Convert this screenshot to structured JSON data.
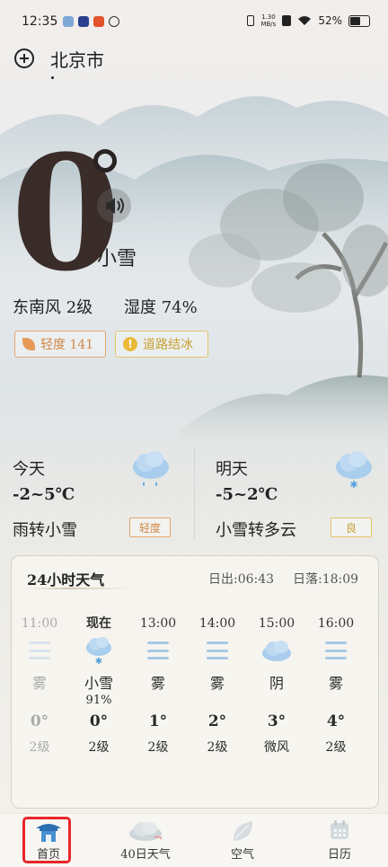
{
  "status_bar": {
    "time": "12:35",
    "net_speed_top": "1.30",
    "net_speed_bottom": "MB/s",
    "battery": "52%"
  },
  "location": {
    "city": "北京市"
  },
  "current": {
    "temperature": "0",
    "condition": "小雪",
    "wind": "东南风 2级",
    "humidity": "湿度 74%",
    "aqi_badge": "轻度 141",
    "alert_badge": "道路结冰"
  },
  "today": {
    "label": "今天",
    "temp": "-2~5℃",
    "condition": "雨转小雪",
    "aqi": "轻度"
  },
  "tomorrow": {
    "label": "明天",
    "temp": "-5~2℃",
    "condition": "小雪转多云",
    "aqi": "良"
  },
  "hourly": {
    "title": "24小时天气",
    "sunrise": "日出:06:43",
    "sunset": "日落:18:09",
    "items": [
      {
        "time": "11:00",
        "icon": "fog-icon",
        "cond": "雾",
        "precip": "",
        "temp": "0°",
        "wind": "2级",
        "past": true
      },
      {
        "time": "现在",
        "icon": "snow-cloud-icon",
        "cond": "小雪",
        "precip": "91%",
        "temp": "0°",
        "wind": "2级",
        "past": false
      },
      {
        "time": "13:00",
        "icon": "fog-icon",
        "cond": "雾",
        "precip": "",
        "temp": "1°",
        "wind": "2级",
        "past": false
      },
      {
        "time": "14:00",
        "icon": "fog-icon",
        "cond": "雾",
        "precip": "",
        "temp": "2°",
        "wind": "2级",
        "past": false
      },
      {
        "time": "15:00",
        "icon": "cloud-icon",
        "cond": "阴",
        "precip": "",
        "temp": "3°",
        "wind": "微风",
        "past": false
      },
      {
        "time": "16:00",
        "icon": "fog-icon",
        "cond": "雾",
        "precip": "",
        "temp": "4°",
        "wind": "2级",
        "past": false
      }
    ]
  },
  "nav": {
    "home": "首页",
    "forecast40": "40日天气",
    "air": "空气",
    "calendar": "日历"
  },
  "colors": {
    "aqi_light": "#d28948",
    "aqi_good": "#c7a132",
    "selected_outline": "#e8262a"
  }
}
